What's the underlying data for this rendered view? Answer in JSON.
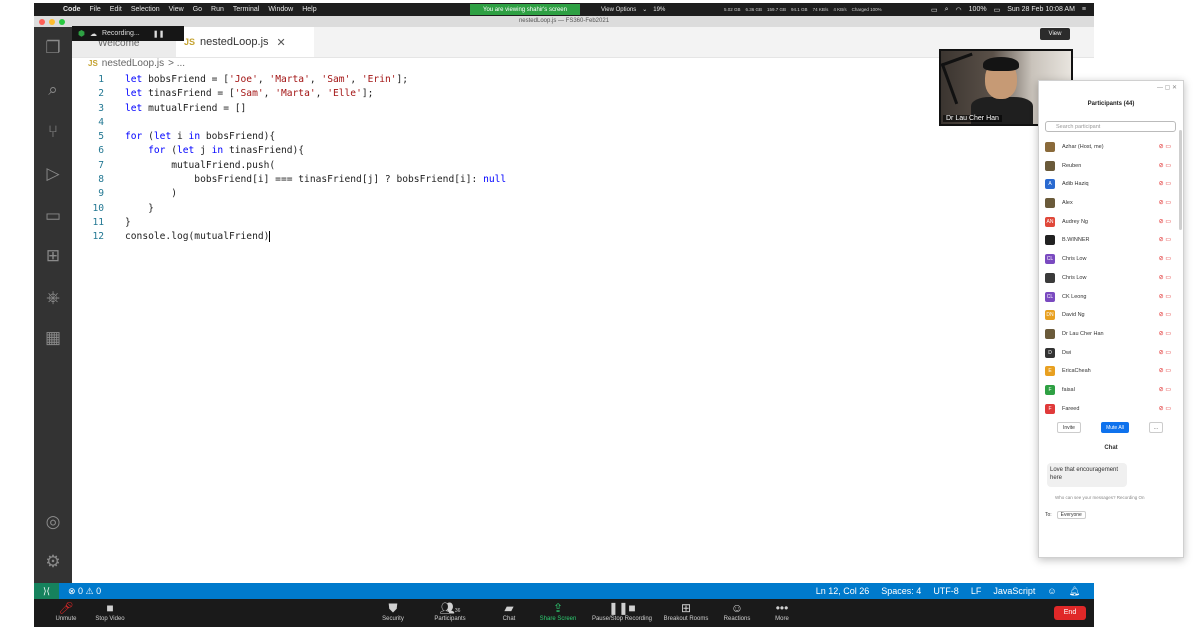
{
  "menubar": {
    "items": [
      "Code",
      "File",
      "Edit",
      "Selection",
      "View",
      "Go",
      "Run",
      "Terminal",
      "Window",
      "Help"
    ],
    "viewing_banner": "You are viewing shahir's screen",
    "view_options": "View Options",
    "battery_pct": "19%",
    "stats": [
      "5.02 GB",
      "6.36 GB",
      "159.7 GB",
      "94.1 GB",
      "74 KB/s",
      "4 KB/s",
      "Charged 100%"
    ],
    "battery": "100%",
    "datetime": "Sun 28 Feb 10:08 AM"
  },
  "window": {
    "title": "nestedLoop.js — FS360-Feb2021"
  },
  "recording": {
    "label": "Recording..."
  },
  "view_button": "View",
  "tabs": {
    "welcome": "Welcome",
    "active": "nestedLoop.js",
    "js_badge": "JS"
  },
  "breadcrumb": {
    "file": "nestedLoop.js",
    "sep": "> ..."
  },
  "code": {
    "lines": [
      {
        "n": "1",
        "t": "let bobsFriend = ['Joe', 'Marta', 'Sam', 'Erin'];"
      },
      {
        "n": "2",
        "t": "let tinasFriend = ['Sam', 'Marta', 'Elle'];"
      },
      {
        "n": "3",
        "t": "let mutualFriend = []"
      },
      {
        "n": "4",
        "t": ""
      },
      {
        "n": "5",
        "t": "for (let i in bobsFriend){"
      },
      {
        "n": "6",
        "t": "    for (let j in tinasFriend){"
      },
      {
        "n": "7",
        "t": "        mutualFriend.push("
      },
      {
        "n": "8",
        "t": "            bobsFriend[i] === tinasFriend[j] ? bobsFriend[i]: null"
      },
      {
        "n": "9",
        "t": "        )"
      },
      {
        "n": "10",
        "t": "    }"
      },
      {
        "n": "11",
        "t": "}"
      },
      {
        "n": "12",
        "t": "console.log(mutualFriend)"
      }
    ]
  },
  "statusbar": {
    "problems": "⊗ 0 ⚠ 0",
    "position": "Ln 12, Col 26",
    "spaces": "Spaces: 4",
    "encoding": "UTF-8",
    "eol": "LF",
    "language": "JavaScript"
  },
  "speaker": {
    "name": "Dr Lau Cher Han"
  },
  "zoom_toolbar": {
    "unmute": "Unmute",
    "stop_video": "Stop Video",
    "security": "Security",
    "participants": "Participants",
    "participants_count": "36",
    "chat": "Chat",
    "share_screen": "Share Screen",
    "pause_recording": "Pause/Stop Recording",
    "breakout": "Breakout Rooms",
    "reactions": "Reactions",
    "more": "More",
    "end": "End"
  },
  "participants_panel": {
    "title": "Participants (44)",
    "search_placeholder": "Search participant",
    "people": [
      {
        "name": "Azhar (Host, me)",
        "initials": "",
        "color": "#8a6a3a"
      },
      {
        "name": "Reuben",
        "initials": "",
        "color": "#6a5a3a"
      },
      {
        "name": "Adib Haziq",
        "initials": "A",
        "color": "#2a6ad0"
      },
      {
        "name": "Alex",
        "initials": "",
        "color": "#6a5a3a"
      },
      {
        "name": "Audrey Ng",
        "initials": "AN",
        "color": "#e0483a"
      },
      {
        "name": "B.WINNER",
        "initials": "",
        "color": "#222222"
      },
      {
        "name": "Chris Low",
        "initials": "CL",
        "color": "#7a4ac0"
      },
      {
        "name": "Chris Low",
        "initials": "",
        "color": "#3a3a3a"
      },
      {
        "name": "CK Leong",
        "initials": "CL",
        "color": "#7a4ac0"
      },
      {
        "name": "David Ng",
        "initials": "DN",
        "color": "#e8a020"
      },
      {
        "name": "Dr Lau Cher Han",
        "initials": "",
        "color": "#6a5a3a"
      },
      {
        "name": "Dwi",
        "initials": "D",
        "color": "#333333"
      },
      {
        "name": "EricaCheah",
        "initials": "E",
        "color": "#e8a020"
      },
      {
        "name": "faisal",
        "initials": "F",
        "color": "#2ea043"
      },
      {
        "name": "Fareed",
        "initials": "F",
        "color": "#e03a3a"
      }
    ],
    "invite": "Invite",
    "mute_all": "Mute All",
    "more": "...",
    "chat_title": "Chat",
    "chat_message": "Love that encouragement here",
    "chat_note": "Who can see your messages? Recording On",
    "to_label": "To:",
    "to_value": "Everyone"
  },
  "colors": {
    "accent": "#007acc",
    "remote": "#16825d",
    "end": "#e02828",
    "viewing": "#2ea043"
  }
}
